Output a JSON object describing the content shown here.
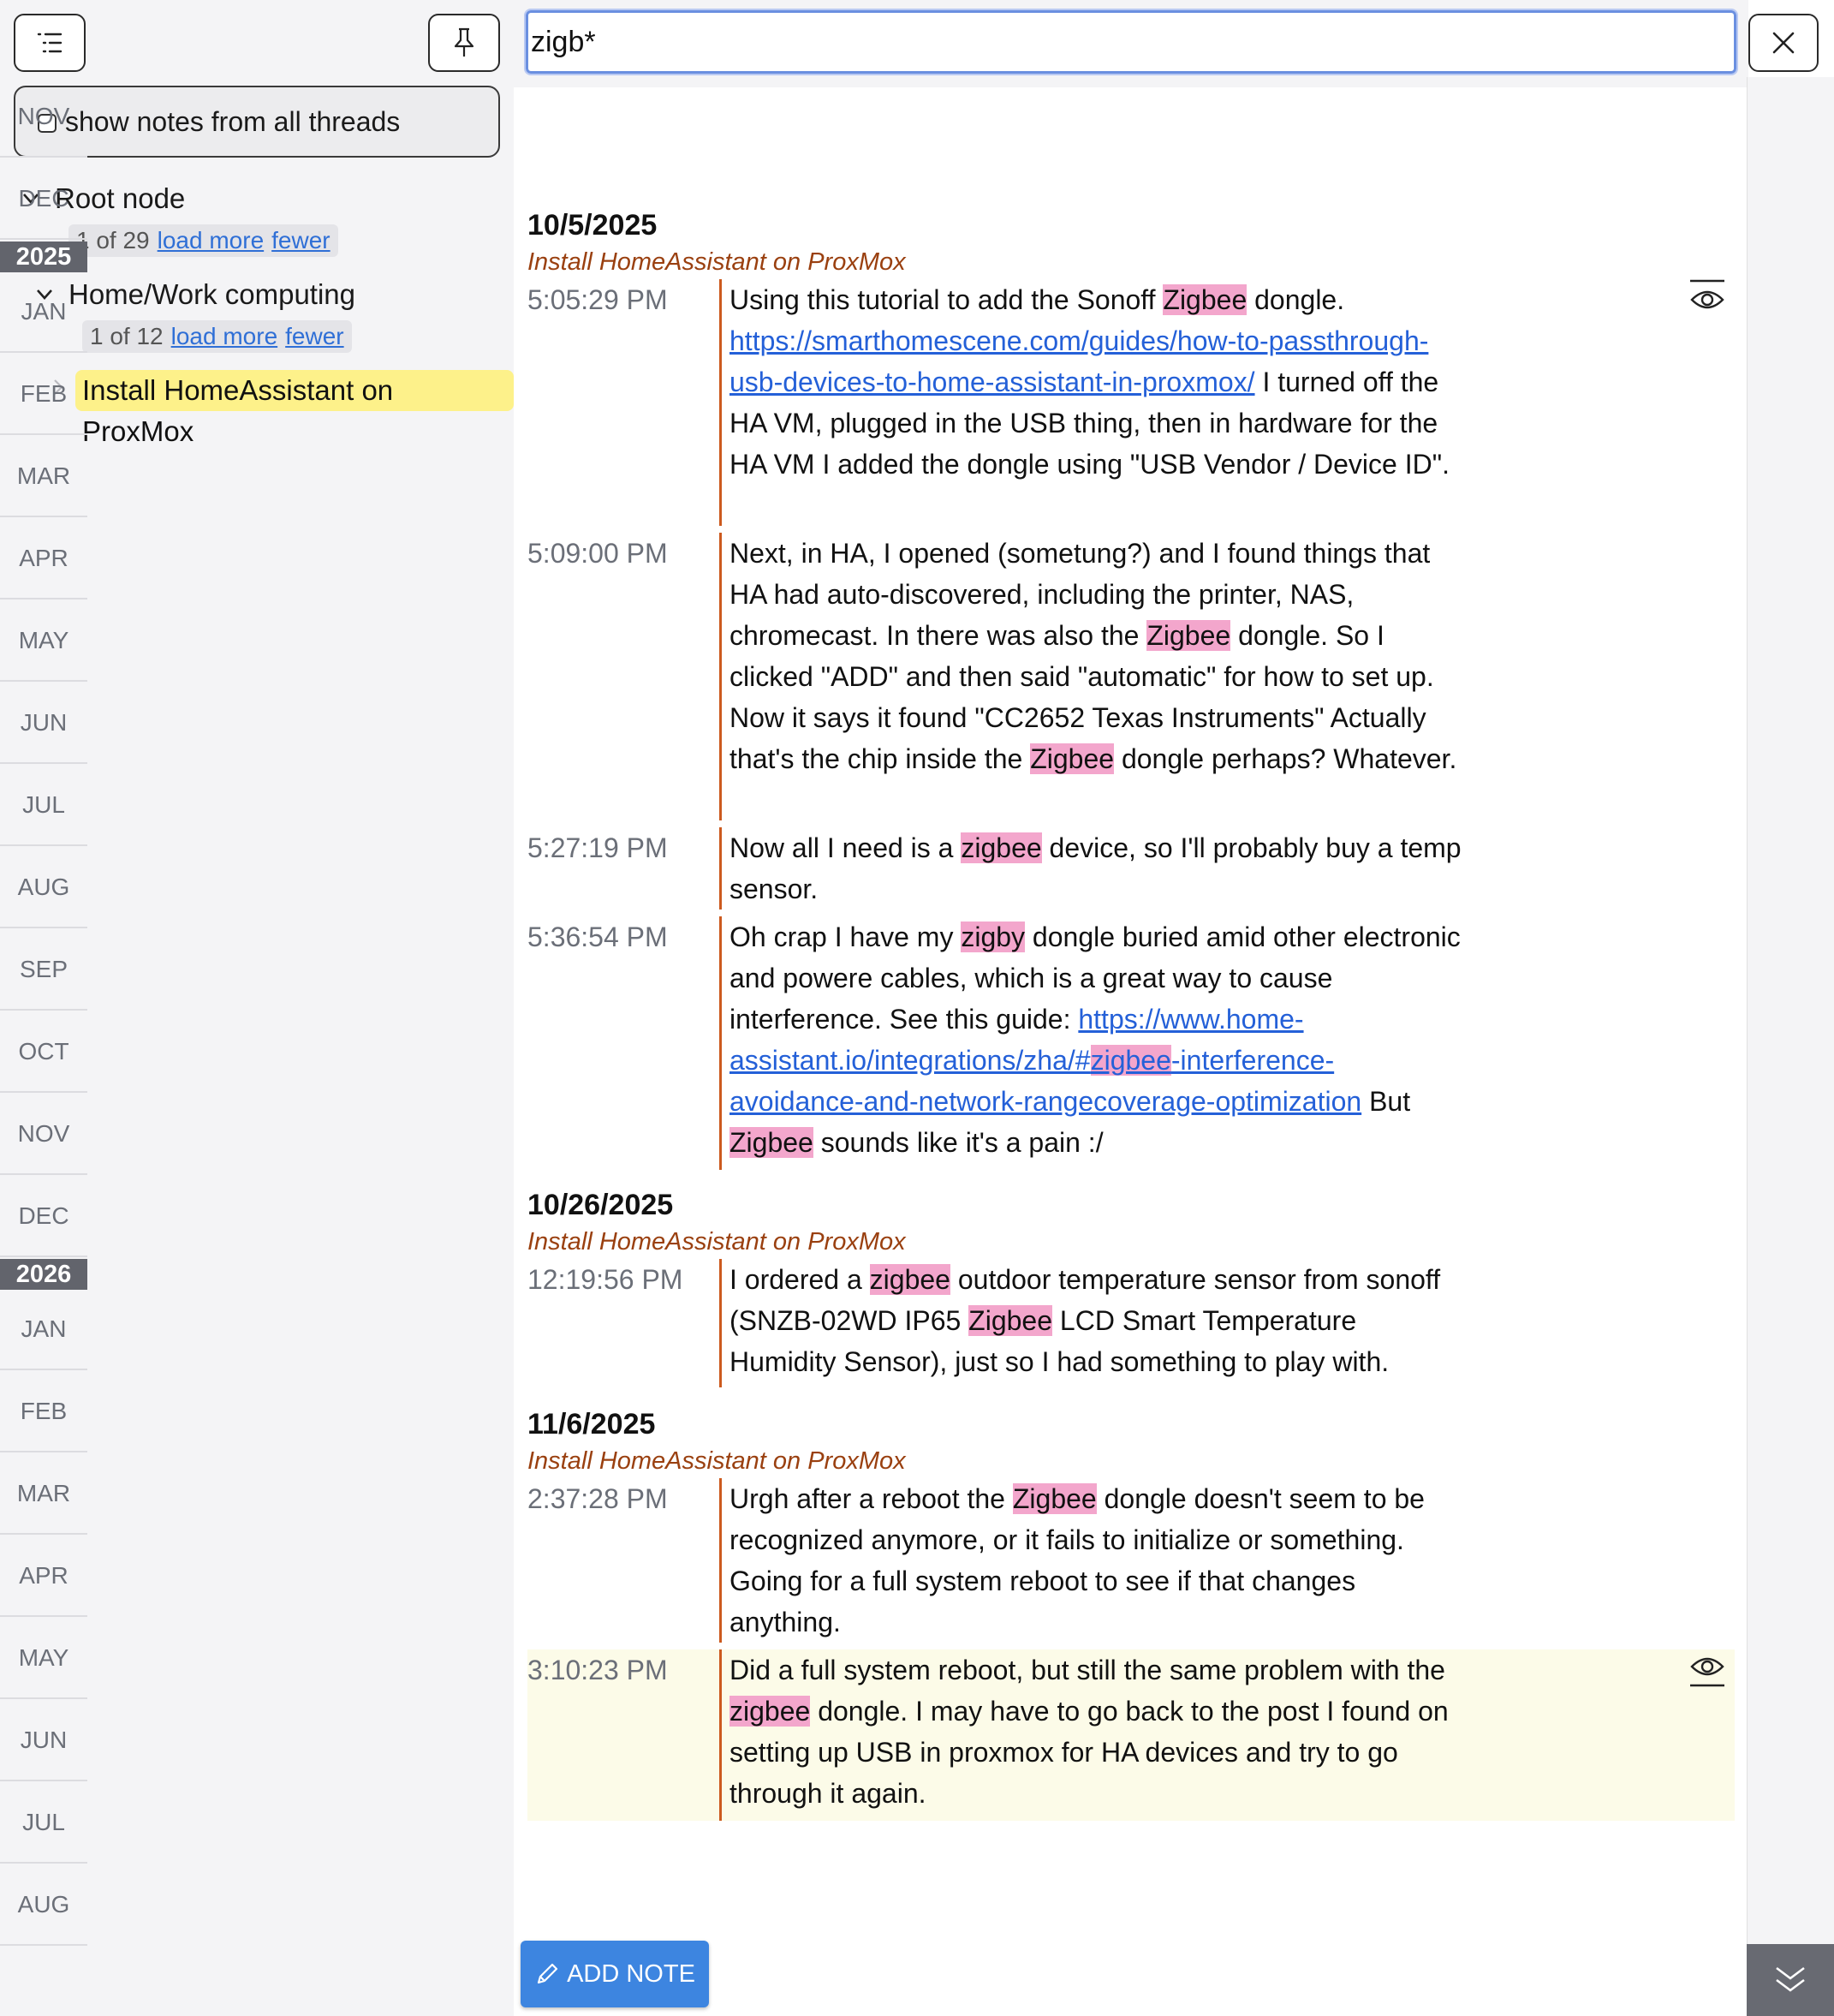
{
  "sidebar": {
    "show_all_label": "show notes from all threads",
    "root": {
      "label": "Root node",
      "pager_count": "1 of 29",
      "load_more": "load more",
      "fewer": "fewer"
    },
    "child": {
      "label": "Home/Work computing",
      "pager_count": "1 of 12",
      "load_more": "load more",
      "fewer": "fewer"
    },
    "active_thread": "Install HomeAssistant on ProxMox"
  },
  "search": {
    "value": "zigb*"
  },
  "timeline": {
    "months_2024_tail": [
      "NOV",
      "DEC"
    ],
    "year_2025": "2025",
    "months_2025": [
      "JAN",
      "FEB",
      "MAR",
      "APR",
      "MAY",
      "JUN",
      "JUL",
      "AUG",
      "SEP",
      "OCT",
      "NOV",
      "DEC"
    ],
    "year_2026": "2026",
    "months_2026": [
      "JAN",
      "FEB",
      "MAR",
      "APR",
      "MAY",
      "JUN",
      "JUL",
      "AUG"
    ]
  },
  "groups": [
    {
      "date": "10/5/2025",
      "thread": "Install HomeAssistant on ProxMox",
      "notes": [
        {
          "time": "5:05:29 PM"
        },
        {
          "time": "5:09:00 PM"
        },
        {
          "time": "5:27:19 PM"
        },
        {
          "time": "5:36:54 PM"
        }
      ]
    },
    {
      "date": "10/26/2025",
      "thread": "Install HomeAssistant on ProxMox",
      "notes": [
        {
          "time": "12:19:56 PM"
        }
      ]
    },
    {
      "date": "11/6/2025",
      "thread": "Install HomeAssistant on ProxMox",
      "notes": [
        {
          "time": "2:37:28 PM"
        },
        {
          "time": "3:10:23 PM"
        }
      ]
    }
  ],
  "notes_text": {
    "n1": {
      "a": "Using this tutorial to add the Sonoff ",
      "h1": "Zigbee",
      "b": " dongle.",
      "link": "https://smarthomescene.com/guides/how-to-passthrough-usb-devices-to-home-assistant-in-proxmox/",
      "c": " I turned off the HA VM, plugged in the USB thing, then in hardware for the HA VM I added the dongle using \"USB Vendor / Device ID\"."
    },
    "n2": {
      "a": "Next, in HA, I opened (sometung?) and I found things that HA had auto-discovered, including the printer, NAS, chromecast. In there was also the ",
      "h1": "Zigbee",
      "b": " dongle. So I clicked \"ADD\" and then said \"automatic\" for how to set up. Now it says it found \"CC2652 Texas Instruments\" Actually that's the chip inside the ",
      "h2": "Zigbee",
      "c": " dongle perhaps? Whatever."
    },
    "n3": {
      "a": "Now all I need is a ",
      "h1": "zigbee",
      "b": " device, so I'll probably buy a temp sensor."
    },
    "n4": {
      "a": "Oh crap I have my ",
      "h1": "zigby",
      "b": " dongle buried amid other electronic and powere cables, which is a great way to cause interference. See this guide: ",
      "link_a": "https://www.home-assistant.io/integrations/zha/#",
      "link_h": "zigbee",
      "link_b": "-interference-avoidance-and-network-rangecoverage-optimization",
      "c": " But ",
      "h2": "Zigbee",
      "d": " sounds like it's a pain :/"
    },
    "n5": {
      "a": "I ordered a ",
      "h1": "zigbee",
      "b": " outdoor temperature sensor from sonoff (SNZB-02WD IP65 ",
      "h2": "Zigbee",
      "c": " LCD Smart Temperature Humidity Sensor), just so I had something to play with."
    },
    "n6": {
      "a": "Urgh after a reboot the ",
      "h1": "Zigbee",
      "b": " dongle doesn't seem to be recognized anymore, or it fails to initialize or something. Going for a full system reboot to see if that changes anything."
    },
    "n7": {
      "a": "Did a full system reboot, but still the same problem with the ",
      "h1": "zigbee",
      "b": " dongle. I may have to go back to the post I found on setting up USB in proxmox for HA devices and try to go through it again."
    }
  },
  "add_note_label": "ADD NOTE"
}
